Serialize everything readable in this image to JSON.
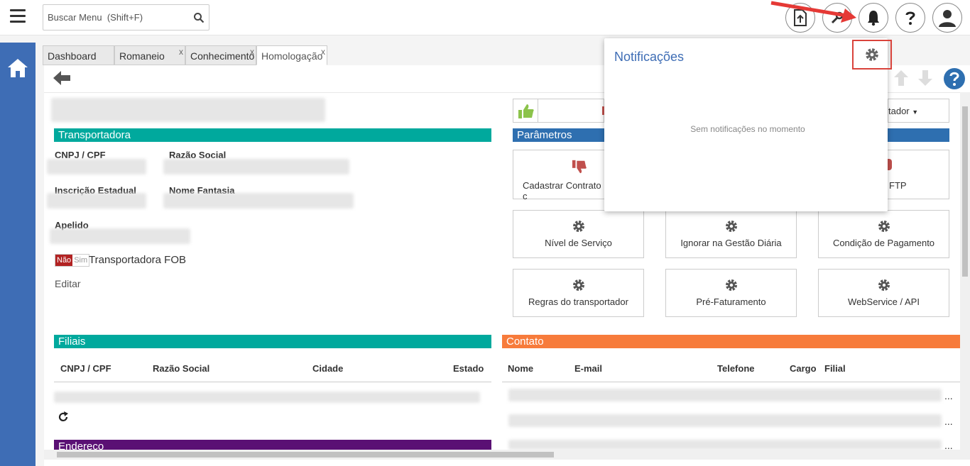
{
  "search": {
    "placeholder": "Buscar Menu  (Shift+F)"
  },
  "tabs": [
    {
      "label": "Dashboard"
    },
    {
      "label": "Romaneio"
    },
    {
      "label": "Conhecimento"
    },
    {
      "label": "Homologação"
    }
  ],
  "tab_close_glyph": "x",
  "sections": {
    "transportadora": "Transportadora",
    "parametros": "Parâmetros",
    "filiais": "Filiais",
    "contato": "Contato",
    "endereco": "Endereço"
  },
  "fields": {
    "cnpj_cpf": "CNPJ / CPF",
    "razao_social": "Razão Social",
    "inscricao_estadual": "Inscrição Estadual",
    "nome_fantasia": "Nome Fantasia",
    "apelido": "Apelido"
  },
  "toggle": {
    "no": "Não",
    "yes": "Sim",
    "label": "Transportadora FOB"
  },
  "editar": "Editar",
  "dropdown_partial": "tador",
  "param_buttons": [
    {
      "label": "Cadastrar Contrato c"
    },
    {
      "label": "FTP"
    },
    {
      "label": "Nível de Serviço"
    },
    {
      "label": "Ignorar na Gestão Diária"
    },
    {
      "label": "Condição de Pagamento"
    },
    {
      "label": "Regras do transportador"
    },
    {
      "label": "Pré-Faturamento"
    },
    {
      "label": "WebService / API"
    }
  ],
  "filiais_columns": [
    "CNPJ / CPF",
    "Razão Social",
    "Cidade",
    "Estado"
  ],
  "contato_columns": [
    "Nome",
    "E-mail",
    "Telefone",
    "Cargo",
    "Filial"
  ],
  "ellipsis": "...",
  "notifications": {
    "title": "Notificações",
    "empty": "Sem notificações no momento"
  },
  "colors": {
    "transportadora": "#00a99d",
    "parametros": "#2e6fb0",
    "filiais": "#00a99d",
    "contato": "#f77b3b",
    "endereco": "#5a1074",
    "sidebar": "#3e6db5",
    "highlight": "#d9433b"
  }
}
